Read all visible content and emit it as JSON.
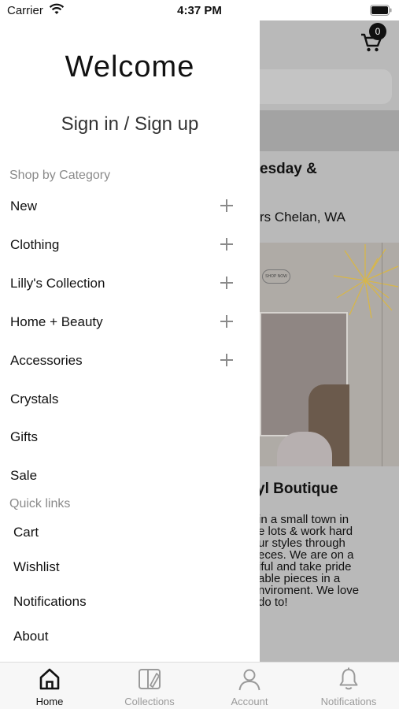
{
  "status_bar": {
    "carrier": "Carrier",
    "time": "4:37 PM"
  },
  "background_page": {
    "cart_count": "0",
    "heading": "esday &",
    "location": "rs Chelan, WA",
    "banner_button": "SHOP NOW",
    "title": "yl Boutique",
    "description_lines": [
      "in a small town in",
      "e lots & work hard",
      "ur styles through",
      "eces. We are on a",
      "iful and take pride",
      "able pieces in a",
      "nviroment. We love",
      "do to!"
    ]
  },
  "drawer": {
    "welcome": "Welcome",
    "sign_in": "Sign in / Sign up",
    "categories_label": "Shop by Category",
    "categories": [
      {
        "label": "New",
        "expandable": true
      },
      {
        "label": "Clothing",
        "expandable": true
      },
      {
        "label": "Lilly's Collection",
        "expandable": true
      },
      {
        "label": "Home + Beauty",
        "expandable": true
      },
      {
        "label": "Accessories",
        "expandable": true
      },
      {
        "label": "Crystals",
        "expandable": false
      },
      {
        "label": "Gifts",
        "expandable": false
      },
      {
        "label": "Sale",
        "expandable": false
      }
    ],
    "quick_links_label": "Quick links",
    "quick_links": [
      {
        "label": "Cart"
      },
      {
        "label": "Wishlist"
      },
      {
        "label": "Notifications"
      },
      {
        "label": "About"
      }
    ]
  },
  "tab_bar": {
    "tabs": [
      {
        "label": "Home",
        "icon": "home-icon",
        "active": true
      },
      {
        "label": "Collections",
        "icon": "collections-icon",
        "active": false
      },
      {
        "label": "Account",
        "icon": "account-icon",
        "active": false
      },
      {
        "label": "Notifications",
        "icon": "bell-icon",
        "active": false
      }
    ]
  }
}
